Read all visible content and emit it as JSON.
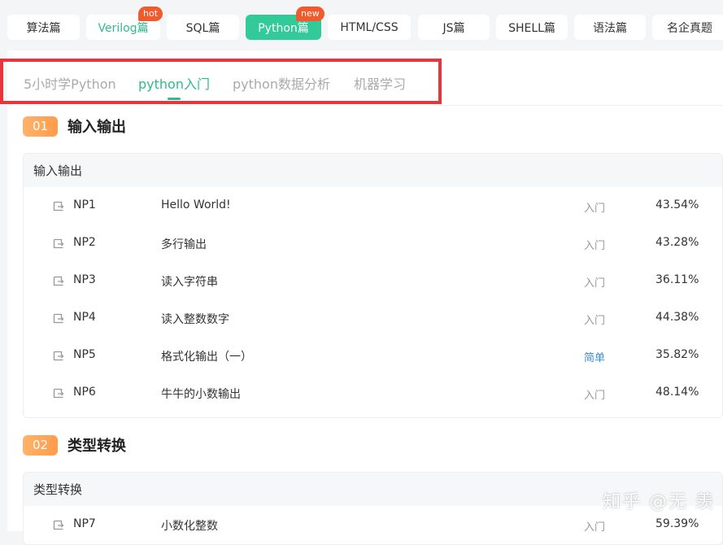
{
  "top_tabs": [
    {
      "label": "算法篇",
      "badge": ""
    },
    {
      "label": "Verilog篇",
      "badge": "hot"
    },
    {
      "label": "SQL篇",
      "badge": ""
    },
    {
      "label": "Python篇",
      "badge": "new"
    },
    {
      "label": "HTML/CSS",
      "badge": ""
    },
    {
      "label": "JS篇",
      "badge": ""
    },
    {
      "label": "SHELL篇",
      "badge": ""
    },
    {
      "label": "语法篇",
      "badge": ""
    },
    {
      "label": "名企真题",
      "badge": ""
    }
  ],
  "active_top_tab": "Python篇",
  "sub_tabs": [
    "5小时学Python",
    "python入门",
    "python数据分析",
    "机器学习"
  ],
  "active_sub_tab": "python入门",
  "sections": [
    {
      "number": "01",
      "title": "输入输出",
      "card_title": "输入输出",
      "rows": [
        {
          "code": "NP1",
          "title": "Hello World!",
          "difficulty": "入门",
          "rate": "43.54%"
        },
        {
          "code": "NP2",
          "title": "多行输出",
          "difficulty": "入门",
          "rate": "43.28%"
        },
        {
          "code": "NP3",
          "title": "读入字符串",
          "difficulty": "入门",
          "rate": "36.11%"
        },
        {
          "code": "NP4",
          "title": "读入整数数字",
          "difficulty": "入门",
          "rate": "44.38%"
        },
        {
          "code": "NP5",
          "title": "格式化输出（一）",
          "difficulty": "简单",
          "rate": "35.82%"
        },
        {
          "code": "NP6",
          "title": "牛牛的小数输出",
          "difficulty": "入门",
          "rate": "48.14%"
        }
      ]
    },
    {
      "number": "02",
      "title": "类型转换",
      "card_title": "类型转换",
      "rows": [
        {
          "code": "NP7",
          "title": "小数化整数",
          "difficulty": "入门",
          "rate": "59.39%"
        }
      ]
    }
  ],
  "watermark": "知乎 @无 羡",
  "colors": {
    "accent": "#2dbc8b",
    "hot_badge": "#f05a2d",
    "highlight": "#e8353b",
    "easy": "#3a8fd6"
  }
}
